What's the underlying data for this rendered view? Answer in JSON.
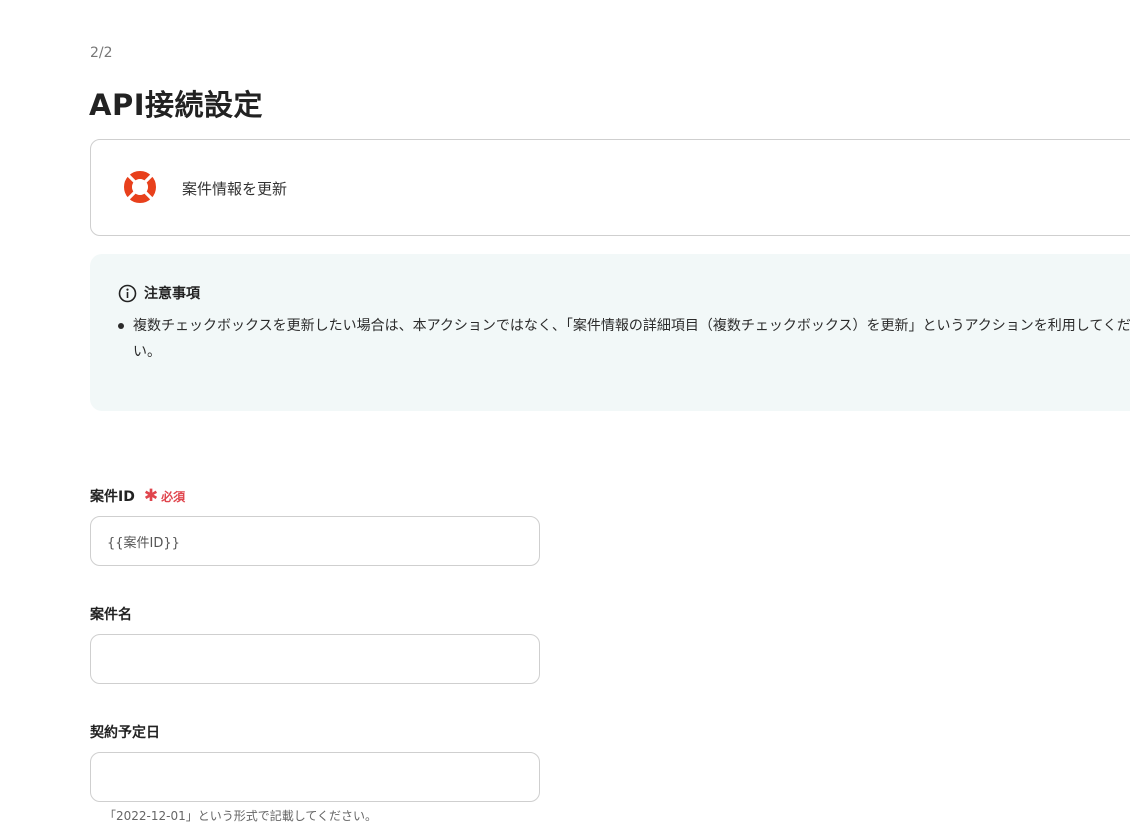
{
  "step_indicator": "2/2",
  "page_title": "API接続設定",
  "app_card": {
    "action_name": "案件情報を更新",
    "icon": "lifebuoy-logo-icon",
    "icon_colors": [
      "#e8401c",
      "#ffffff"
    ]
  },
  "notice": {
    "icon": "info-circle-icon",
    "title": "注意事項",
    "items": [
      "複数チェックボックスを更新したい場合は、本アクションではなく、「案件情報の詳細項目（複数チェックボックス）を更新」というアクションを利用してください。"
    ]
  },
  "fields": {
    "deal_id": {
      "label": "案件ID",
      "required_mark": "✱",
      "required_text": "必須",
      "value": "{{案件ID}}"
    },
    "deal_name": {
      "label": "案件名",
      "value": ""
    },
    "contract_date": {
      "label": "契約予定日",
      "value": "",
      "hint": "「2022-12-01」という形式で記載してください。"
    }
  },
  "colors": {
    "required": "#e0454d",
    "notice_bg": "#f2f8f8",
    "border": "#cfcfcf"
  }
}
